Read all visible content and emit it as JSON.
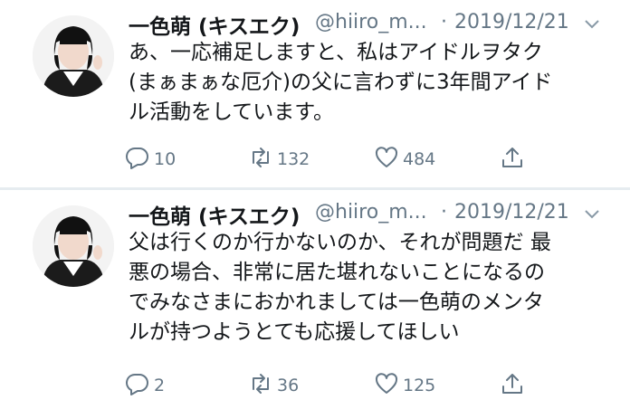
{
  "tweets": [
    {
      "name": "一色萌 (キスエク)",
      "handle": "@hiiro_m...",
      "separator": "·",
      "date": "2019/12/21",
      "text": "あ、一応補足しますと、私はアイドルヲタク\n(まぁまぁな厄介)の父に言わずに3年間アイド\nル活動をしています。",
      "replies": "10",
      "retweets": "132",
      "likes": "484"
    },
    {
      "name": "一色萌 (キスエク)",
      "handle": "@hiiro_m...",
      "separator": "·",
      "date": "2019/12/21",
      "text": "父は行くのか行かないのか、それが問題だ 最\n悪の場合、非常に居た堪れないことになるの\nでみなさまにおかれましては一色萌のメンタ\nルが持つようとても応援してほしい",
      "replies": "2",
      "retweets": "36",
      "likes": "125"
    }
  ],
  "icons": {
    "reply": "reply-icon",
    "retweet": "retweet-icon",
    "like": "heart-icon",
    "share": "share-icon",
    "menu": "chevron-down-icon"
  },
  "colors": {
    "text": "#14171a",
    "secondary": "#657786",
    "divider": "#e6ecf0"
  }
}
